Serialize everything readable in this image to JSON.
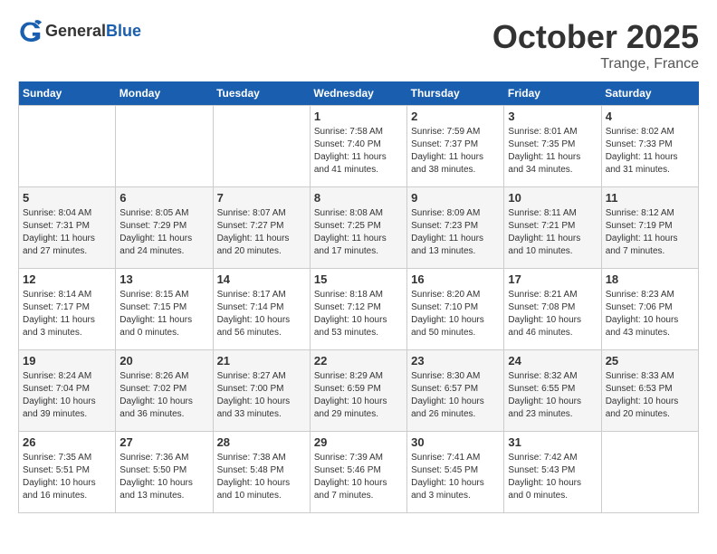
{
  "header": {
    "logo_general": "General",
    "logo_blue": "Blue",
    "month": "October 2025",
    "location": "Trange, France"
  },
  "days_of_week": [
    "Sunday",
    "Monday",
    "Tuesday",
    "Wednesday",
    "Thursday",
    "Friday",
    "Saturday"
  ],
  "weeks": [
    [
      {
        "day": "",
        "sunrise": "",
        "sunset": "",
        "daylight": ""
      },
      {
        "day": "",
        "sunrise": "",
        "sunset": "",
        "daylight": ""
      },
      {
        "day": "",
        "sunrise": "",
        "sunset": "",
        "daylight": ""
      },
      {
        "day": "1",
        "sunrise": "Sunrise: 7:58 AM",
        "sunset": "Sunset: 7:40 PM",
        "daylight": "Daylight: 11 hours and 41 minutes."
      },
      {
        "day": "2",
        "sunrise": "Sunrise: 7:59 AM",
        "sunset": "Sunset: 7:37 PM",
        "daylight": "Daylight: 11 hours and 38 minutes."
      },
      {
        "day": "3",
        "sunrise": "Sunrise: 8:01 AM",
        "sunset": "Sunset: 7:35 PM",
        "daylight": "Daylight: 11 hours and 34 minutes."
      },
      {
        "day": "4",
        "sunrise": "Sunrise: 8:02 AM",
        "sunset": "Sunset: 7:33 PM",
        "daylight": "Daylight: 11 hours and 31 minutes."
      }
    ],
    [
      {
        "day": "5",
        "sunrise": "Sunrise: 8:04 AM",
        "sunset": "Sunset: 7:31 PM",
        "daylight": "Daylight: 11 hours and 27 minutes."
      },
      {
        "day": "6",
        "sunrise": "Sunrise: 8:05 AM",
        "sunset": "Sunset: 7:29 PM",
        "daylight": "Daylight: 11 hours and 24 minutes."
      },
      {
        "day": "7",
        "sunrise": "Sunrise: 8:07 AM",
        "sunset": "Sunset: 7:27 PM",
        "daylight": "Daylight: 11 hours and 20 minutes."
      },
      {
        "day": "8",
        "sunrise": "Sunrise: 8:08 AM",
        "sunset": "Sunset: 7:25 PM",
        "daylight": "Daylight: 11 hours and 17 minutes."
      },
      {
        "day": "9",
        "sunrise": "Sunrise: 8:09 AM",
        "sunset": "Sunset: 7:23 PM",
        "daylight": "Daylight: 11 hours and 13 minutes."
      },
      {
        "day": "10",
        "sunrise": "Sunrise: 8:11 AM",
        "sunset": "Sunset: 7:21 PM",
        "daylight": "Daylight: 11 hours and 10 minutes."
      },
      {
        "day": "11",
        "sunrise": "Sunrise: 8:12 AM",
        "sunset": "Sunset: 7:19 PM",
        "daylight": "Daylight: 11 hours and 7 minutes."
      }
    ],
    [
      {
        "day": "12",
        "sunrise": "Sunrise: 8:14 AM",
        "sunset": "Sunset: 7:17 PM",
        "daylight": "Daylight: 11 hours and 3 minutes."
      },
      {
        "day": "13",
        "sunrise": "Sunrise: 8:15 AM",
        "sunset": "Sunset: 7:15 PM",
        "daylight": "Daylight: 11 hours and 0 minutes."
      },
      {
        "day": "14",
        "sunrise": "Sunrise: 8:17 AM",
        "sunset": "Sunset: 7:14 PM",
        "daylight": "Daylight: 10 hours and 56 minutes."
      },
      {
        "day": "15",
        "sunrise": "Sunrise: 8:18 AM",
        "sunset": "Sunset: 7:12 PM",
        "daylight": "Daylight: 10 hours and 53 minutes."
      },
      {
        "day": "16",
        "sunrise": "Sunrise: 8:20 AM",
        "sunset": "Sunset: 7:10 PM",
        "daylight": "Daylight: 10 hours and 50 minutes."
      },
      {
        "day": "17",
        "sunrise": "Sunrise: 8:21 AM",
        "sunset": "Sunset: 7:08 PM",
        "daylight": "Daylight: 10 hours and 46 minutes."
      },
      {
        "day": "18",
        "sunrise": "Sunrise: 8:23 AM",
        "sunset": "Sunset: 7:06 PM",
        "daylight": "Daylight: 10 hours and 43 minutes."
      }
    ],
    [
      {
        "day": "19",
        "sunrise": "Sunrise: 8:24 AM",
        "sunset": "Sunset: 7:04 PM",
        "daylight": "Daylight: 10 hours and 39 minutes."
      },
      {
        "day": "20",
        "sunrise": "Sunrise: 8:26 AM",
        "sunset": "Sunset: 7:02 PM",
        "daylight": "Daylight: 10 hours and 36 minutes."
      },
      {
        "day": "21",
        "sunrise": "Sunrise: 8:27 AM",
        "sunset": "Sunset: 7:00 PM",
        "daylight": "Daylight: 10 hours and 33 minutes."
      },
      {
        "day": "22",
        "sunrise": "Sunrise: 8:29 AM",
        "sunset": "Sunset: 6:59 PM",
        "daylight": "Daylight: 10 hours and 29 minutes."
      },
      {
        "day": "23",
        "sunrise": "Sunrise: 8:30 AM",
        "sunset": "Sunset: 6:57 PM",
        "daylight": "Daylight: 10 hours and 26 minutes."
      },
      {
        "day": "24",
        "sunrise": "Sunrise: 8:32 AM",
        "sunset": "Sunset: 6:55 PM",
        "daylight": "Daylight: 10 hours and 23 minutes."
      },
      {
        "day": "25",
        "sunrise": "Sunrise: 8:33 AM",
        "sunset": "Sunset: 6:53 PM",
        "daylight": "Daylight: 10 hours and 20 minutes."
      }
    ],
    [
      {
        "day": "26",
        "sunrise": "Sunrise: 7:35 AM",
        "sunset": "Sunset: 5:51 PM",
        "daylight": "Daylight: 10 hours and 16 minutes."
      },
      {
        "day": "27",
        "sunrise": "Sunrise: 7:36 AM",
        "sunset": "Sunset: 5:50 PM",
        "daylight": "Daylight: 10 hours and 13 minutes."
      },
      {
        "day": "28",
        "sunrise": "Sunrise: 7:38 AM",
        "sunset": "Sunset: 5:48 PM",
        "daylight": "Daylight: 10 hours and 10 minutes."
      },
      {
        "day": "29",
        "sunrise": "Sunrise: 7:39 AM",
        "sunset": "Sunset: 5:46 PM",
        "daylight": "Daylight: 10 hours and 7 minutes."
      },
      {
        "day": "30",
        "sunrise": "Sunrise: 7:41 AM",
        "sunset": "Sunset: 5:45 PM",
        "daylight": "Daylight: 10 hours and 3 minutes."
      },
      {
        "day": "31",
        "sunrise": "Sunrise: 7:42 AM",
        "sunset": "Sunset: 5:43 PM",
        "daylight": "Daylight: 10 hours and 0 minutes."
      },
      {
        "day": "",
        "sunrise": "",
        "sunset": "",
        "daylight": ""
      }
    ]
  ]
}
